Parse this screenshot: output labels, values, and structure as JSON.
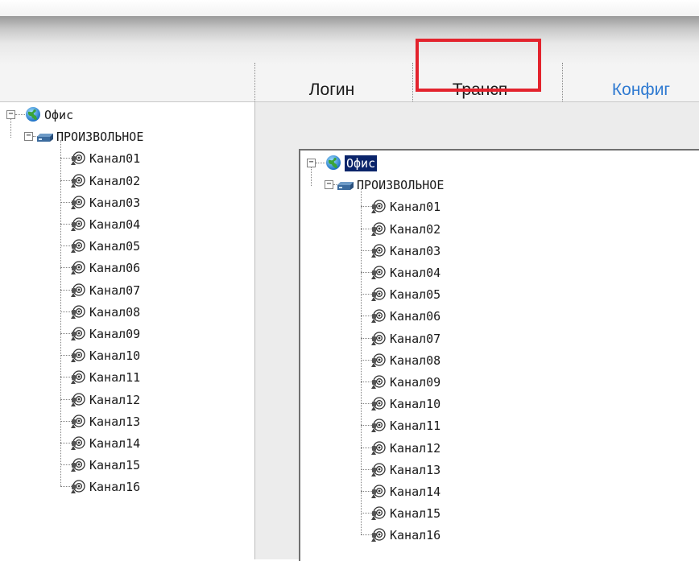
{
  "tabs": [
    {
      "label": "Логин"
    },
    {
      "label": "Трансп"
    },
    {
      "label": "Конфиг"
    }
  ],
  "tree": {
    "root": "Офис",
    "device": "ПРОИЗВОЛЬНОЕ",
    "channels": [
      "Канал01",
      "Канал02",
      "Канал03",
      "Канал04",
      "Канал05",
      "Канал06",
      "Канал07",
      "Канал08",
      "Канал09",
      "Канал10",
      "Канал11",
      "Канал12",
      "Канал13",
      "Канал14",
      "Канал15",
      "Канал16"
    ]
  },
  "icons": {
    "root": "globe-icon",
    "device": "dvr-device-icon",
    "channel": "camera-icon",
    "expander": "collapse-minus-icon"
  },
  "colors": {
    "highlight": "#e3232d",
    "active_tab": "#2f7ad1",
    "selection": "#0a246a"
  }
}
